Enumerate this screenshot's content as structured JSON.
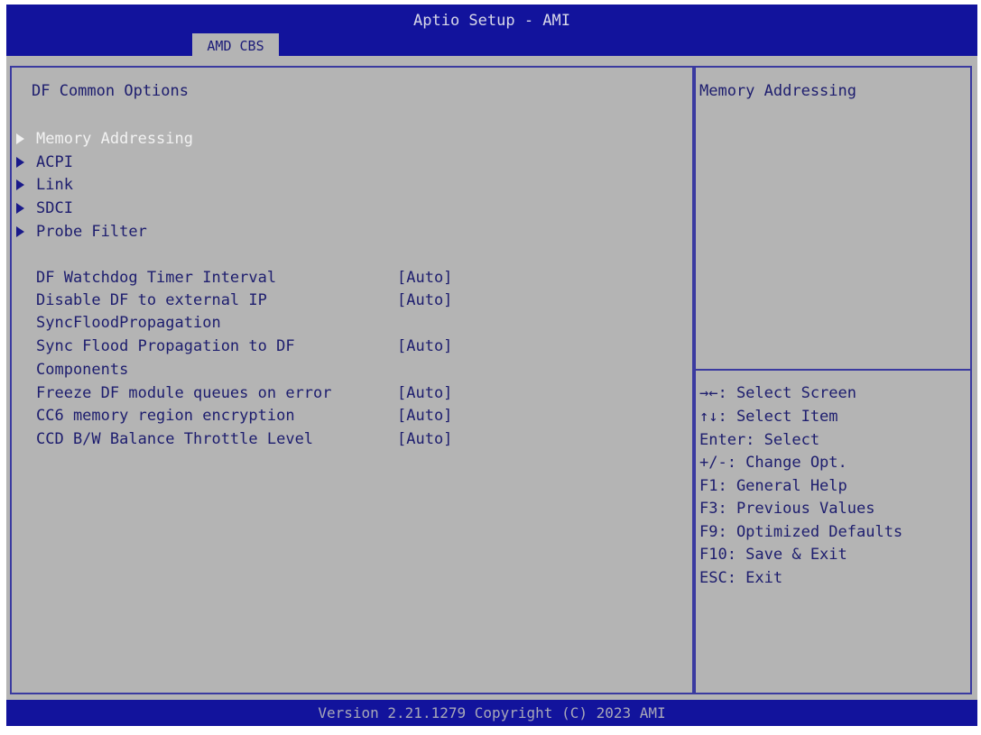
{
  "header": {
    "title": "Aptio Setup - AMI",
    "active_tab": "AMD CBS"
  },
  "main": {
    "section_title": "DF Common Options",
    "submenus": [
      {
        "label": "Memory Addressing",
        "selected": true
      },
      {
        "label": "ACPI",
        "selected": false
      },
      {
        "label": "Link",
        "selected": false
      },
      {
        "label": "SDCI",
        "selected": false
      },
      {
        "label": "Probe Filter",
        "selected": false
      }
    ],
    "options": [
      {
        "label": "DF Watchdog Timer Interval",
        "value": "[Auto]"
      },
      {
        "label": "Disable DF to external IP",
        "label_line2": "SyncFloodPropagation",
        "value": "[Auto]"
      },
      {
        "label": "Sync Flood Propagation to DF",
        "label_line2": "Components",
        "value": "[Auto]"
      },
      {
        "label": "Freeze DF module queues on error",
        "value": "[Auto]"
      },
      {
        "label": "CC6 memory region encryption",
        "value": "[Auto]"
      },
      {
        "label": "CCD B/W Balance Throttle Level",
        "value": "[Auto]"
      }
    ]
  },
  "help": {
    "description": "Memory Addressing",
    "keys": [
      {
        "icon": "left-right-arrows-icon",
        "text": "→←: Select Screen"
      },
      {
        "icon": "up-down-arrows-icon",
        "text": "↑↓: Select Item"
      },
      {
        "text": "Enter: Select"
      },
      {
        "text": "+/-: Change Opt."
      },
      {
        "text": "F1: General Help"
      },
      {
        "text": "F3: Previous Values"
      },
      {
        "text": "F9: Optimized Defaults"
      },
      {
        "text": "F10: Save & Exit"
      },
      {
        "text": "ESC: Exit"
      }
    ]
  },
  "footer": {
    "text": "Version 2.21.1279 Copyright (C) 2023 AMI"
  },
  "colors": {
    "header_bg": "#12139c",
    "panel_bg": "#b4b4b4",
    "text": "#1d1d6e",
    "selected_text": "#f2f2f2",
    "border": "#3a3aa0"
  }
}
